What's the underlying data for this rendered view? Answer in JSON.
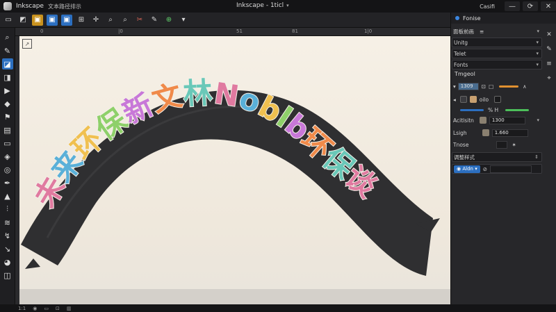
{
  "window": {
    "app_name": "Inkscape",
    "doc_name": "文本路径排示",
    "center_title": "Inkscape - 1ticl",
    "right_label": "Casifi",
    "controls": [
      "—",
      "⟳",
      "✕"
    ]
  },
  "toolbar": {
    "commands": [
      {
        "icon": "new-doc-icon",
        "glyph": "▭",
        "style": ""
      },
      {
        "icon": "open-icon",
        "glyph": "◩",
        "style": ""
      },
      {
        "icon": "node-edit-icon",
        "glyph": "▣",
        "style": "orange"
      },
      {
        "icon": "select-frame-icon",
        "glyph": "▣",
        "style": "blue"
      },
      {
        "icon": "transform-icon",
        "glyph": "▣",
        "style": "blue"
      },
      {
        "icon": "align-icon",
        "glyph": "⊞",
        "style": ""
      },
      {
        "icon": "snap-icon",
        "glyph": "✛",
        "style": ""
      },
      {
        "icon": "zoom-icon",
        "glyph": "⌕",
        "style": ""
      },
      {
        "icon": "zoom-out-icon",
        "glyph": "⌕",
        "style": ""
      },
      {
        "icon": "cut-icon",
        "glyph": "✂",
        "style": "red"
      },
      {
        "icon": "pen-icon",
        "glyph": "✎",
        "style": ""
      },
      {
        "icon": "export-icon",
        "glyph": "⊕",
        "style": "green"
      },
      {
        "icon": "dropdown-icon",
        "glyph": "▾",
        "style": ""
      }
    ]
  },
  "tools": [
    {
      "icon": "search-icon",
      "glyph": "⌕",
      "active": false
    },
    {
      "icon": "pencil-icon",
      "glyph": "✎",
      "active": false
    },
    {
      "icon": "node-tool-icon",
      "glyph": "◪",
      "active": true
    },
    {
      "icon": "tweak-icon",
      "glyph": "◨",
      "active": false
    },
    {
      "icon": "shape-icon",
      "glyph": "▶",
      "active": false
    },
    {
      "icon": "star-icon",
      "glyph": "◆",
      "active": false
    },
    {
      "icon": "flag-icon",
      "glyph": "⚑",
      "active": false
    },
    {
      "icon": "text-icon",
      "glyph": "▤",
      "active": false
    },
    {
      "icon": "rect-icon",
      "glyph": "▭",
      "active": false
    },
    {
      "icon": "cube-icon",
      "glyph": "◈",
      "active": false
    },
    {
      "icon": "spiral-icon",
      "glyph": "◎",
      "active": false
    },
    {
      "icon": "calligraphy-icon",
      "glyph": "✒",
      "active": false
    },
    {
      "icon": "gradient-icon",
      "glyph": "▲",
      "active": false
    },
    {
      "icon": "dropper-icon",
      "glyph": "⫶",
      "active": false
    },
    {
      "icon": "spray-icon",
      "glyph": "≋",
      "active": false
    },
    {
      "icon": "connector-icon",
      "glyph": "↯",
      "active": false
    },
    {
      "icon": "measure-icon",
      "glyph": "↘",
      "active": false
    },
    {
      "icon": "bucket-icon",
      "glyph": "◕",
      "active": false
    },
    {
      "icon": "eraser-icon",
      "glyph": "◫",
      "active": false
    }
  ],
  "ruler": {
    "marks": [
      "0",
      "|0",
      "51",
      "81",
      "1|0"
    ]
  },
  "canvas": {
    "path_text": "未来环保新文林Noblb环保谈",
    "arc_colors": [
      "#e07aa0",
      "#5ab0d8",
      "#f0c050",
      "#8ed06a",
      "#c878d8",
      "#f08a4a",
      "#6ac8b8"
    ]
  },
  "panel": {
    "title": "Fonise",
    "subtitle": "面板前画",
    "dropdowns": [
      "Unitg",
      "Telet",
      "Fonts"
    ],
    "section": "Tmgeol",
    "field_value": "1309",
    "label_a": "oilo",
    "label_b": "% H",
    "attr_label": "Acitlsitn",
    "attr_value": "1300",
    "length_label": "Lsigh",
    "length_value": "1.660",
    "toggle_label": "Tnose",
    "group_label": "调整样式",
    "mode_label": "Aldn",
    "colors": {
      "accent": "#2c6fc0",
      "green": "#4cbf5a",
      "orange": "#e09030"
    }
  },
  "status": {
    "items": [
      "1:1",
      "◉",
      "▭",
      "⊡",
      "▥"
    ]
  }
}
